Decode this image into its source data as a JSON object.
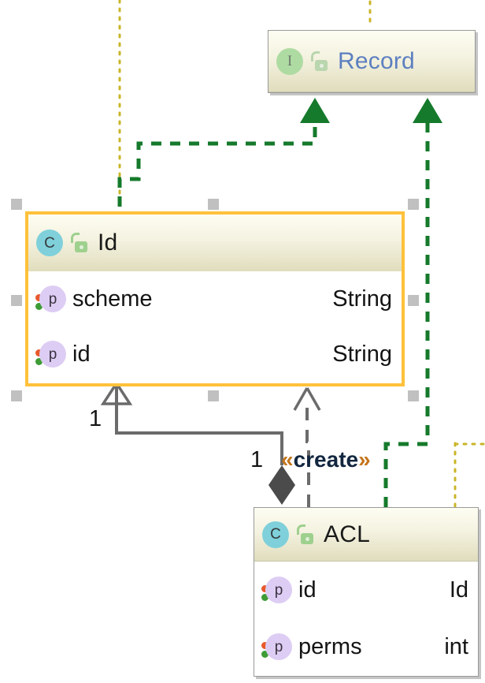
{
  "diagram": {
    "type": "uml-class-diagram",
    "background": "#ffffff",
    "selection_color": "#ffc13b",
    "guide_color": "#c9b528"
  },
  "classes": [
    {
      "id": "record",
      "name": "Record",
      "kind": "interface",
      "kind_icon": "interface-icon",
      "kind_letter": "I",
      "visibility_icon": "unlocked-padlock-icon",
      "selected": false,
      "title_color": "#5c7fc0",
      "attributes": []
    },
    {
      "id": "id",
      "name": "Id",
      "kind": "class",
      "kind_icon": "class-icon",
      "kind_letter": "C",
      "visibility_icon": "unlocked-padlock-icon",
      "selected": true,
      "title_color": "#1a1a1a",
      "attributes": [
        {
          "icon": "property-icon",
          "letter": "p",
          "name": "scheme",
          "type": "String"
        },
        {
          "icon": "property-icon",
          "letter": "p",
          "name": "id",
          "type": "String"
        }
      ]
    },
    {
      "id": "acl",
      "name": "ACL",
      "kind": "class",
      "kind_icon": "class-icon",
      "kind_letter": "C",
      "visibility_icon": "unlocked-padlock-icon",
      "selected": false,
      "title_color": "#1a1a1a",
      "attributes": [
        {
          "icon": "property-icon",
          "letter": "p",
          "name": "id",
          "type": "Id"
        },
        {
          "icon": "property-icon",
          "letter": "p",
          "name": "perms",
          "type": "int"
        }
      ]
    }
  ],
  "relationships": [
    {
      "id": "id-realizes-record",
      "kind": "realization",
      "from": "Id",
      "to": "Record",
      "style": "dashed",
      "color": "#157a2b",
      "arrowhead": "filled-triangle",
      "label": ""
    },
    {
      "id": "acl-realizes-record",
      "kind": "realization",
      "from": "ACL",
      "to": "Record",
      "style": "dashed",
      "color": "#157a2b",
      "arrowhead": "filled-triangle",
      "label": ""
    },
    {
      "id": "acl-generalizes-id",
      "kind": "generalization",
      "from": "ACL",
      "to": "Id",
      "style": "solid",
      "color": "#6b6b6b",
      "arrowhead": "open-triangle",
      "label": ""
    },
    {
      "id": "acl-creates-id",
      "kind": "dependency",
      "from": "ACL",
      "to": "Id",
      "style": "dashed",
      "color": "#6b6b6b",
      "arrowhead": "open-arrow",
      "label": "«create»"
    },
    {
      "id": "id-composes-acl",
      "kind": "composition",
      "from": "Id",
      "to": "ACL",
      "style": "solid",
      "color": "#6b6b6b",
      "arrowhead": "filled-diamond",
      "label": ""
    }
  ],
  "edge_labels": [
    {
      "id": "mult-source",
      "text": "1"
    },
    {
      "id": "mult-target",
      "text": "1"
    },
    {
      "id": "stereotype-create-open",
      "text": "«"
    },
    {
      "id": "stereotype-create-word",
      "text": "create"
    },
    {
      "id": "stereotype-create-close",
      "text": "»"
    }
  ],
  "selection": {
    "target": "Id",
    "handle_count": 8,
    "handle_color": "#c0c0c0"
  }
}
